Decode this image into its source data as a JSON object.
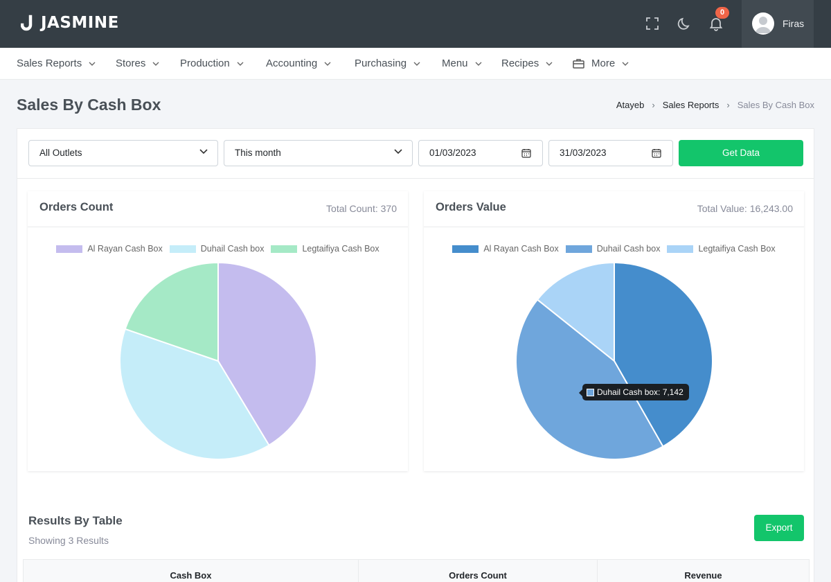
{
  "app": {
    "brand": "JASMINE"
  },
  "topbar": {
    "notification_count": "0",
    "user_name": "Firas"
  },
  "nav": {
    "items": [
      {
        "label": "Sales Reports"
      },
      {
        "label": "Stores"
      },
      {
        "label": "Production"
      },
      {
        "label": "Accounting"
      },
      {
        "label": "Purchasing"
      },
      {
        "label": "Menu"
      },
      {
        "label": "Recipes"
      },
      {
        "label": "More",
        "icon": "briefcase-icon"
      }
    ]
  },
  "page": {
    "title": "Sales By Cash Box",
    "breadcrumb": [
      "Atayeb",
      "Sales Reports",
      "Sales By Cash Box"
    ]
  },
  "filters": {
    "outlet": "All Outlets",
    "period": "This month",
    "date_from": "01/03/2023",
    "date_to": "31/03/2023",
    "submit_label": "Get Data"
  },
  "cards": {
    "orders_count": {
      "title": "Orders Count",
      "total": "Total Count: 370"
    },
    "orders_value": {
      "title": "Orders Value",
      "total": "Total Value: 16,243.00"
    }
  },
  "chart_data": [
    {
      "type": "pie",
      "categories": [
        "Al Rayan Cash Box",
        "Duhail Cash box",
        "Legtaifiya Cash Box"
      ],
      "values": [
        153,
        144,
        73
      ],
      "colors": [
        "#c4bcee",
        "#c5edf9",
        "#a5e9c6"
      ],
      "legend": "top"
    },
    {
      "type": "pie",
      "categories": [
        "Al Rayan Cash Box",
        "Duhail Cash box",
        "Legtaifiya Cash Box"
      ],
      "values": [
        6781,
        7142,
        2320
      ],
      "colors": [
        "#458dcc",
        "#6fa6dc",
        "#aad4f7"
      ],
      "legend": "top",
      "tooltip": "Duhail Cash box: 7,142"
    }
  ],
  "results": {
    "title": "Results By Table",
    "subtitle": "Showing 3 Results",
    "export_label": "Export",
    "columns": [
      "Cash Box",
      "Orders Count",
      "Revenue"
    ]
  },
  "colors": {
    "topbar": "#353e45",
    "accent_green": "#13c56b",
    "badge": "#f06548"
  }
}
